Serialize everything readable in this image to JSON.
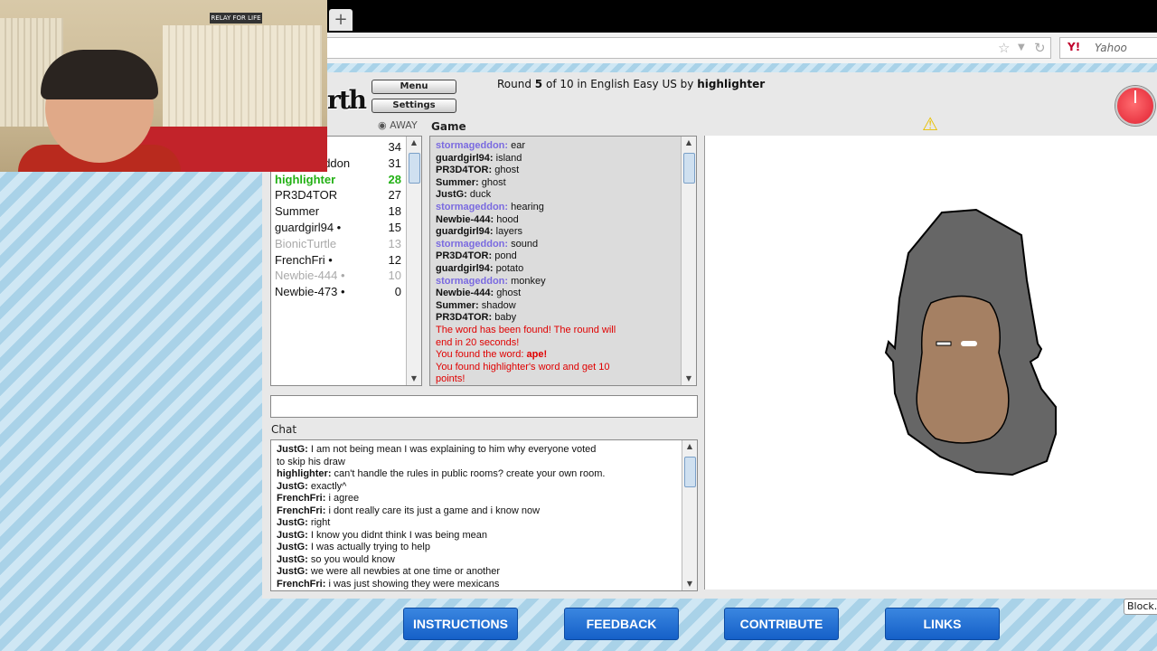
{
  "browser": {
    "newtab": "+",
    "search_engine": "Yahoo",
    "search_logo": "Y!"
  },
  "webcam": {
    "poster_text": "RELAY FOR LIFE"
  },
  "game": {
    "menu_label": "Menu",
    "settings_label": "Settings",
    "logo_text": "rth",
    "round_prefix": "Round ",
    "round_num": "5",
    "round_mid": " of 10 in English Easy US by ",
    "drawer": "highlighter",
    "away_label": "AWAY",
    "game_label": "Game",
    "chat_label": "Chat",
    "block_label": "Block..."
  },
  "players": [
    {
      "name": "",
      "score": "34",
      "color": "#111"
    },
    {
      "name": "stormageddon",
      "score": "31",
      "color": "#111"
    },
    {
      "name": "highlighter",
      "score": "28",
      "color": "#22b014"
    },
    {
      "name": "PR3D4TOR",
      "score": "27",
      "color": "#111"
    },
    {
      "name": "Summer",
      "score": "18",
      "color": "#111"
    },
    {
      "name": "guardgirl94 •",
      "score": "15",
      "color": "#111"
    },
    {
      "name": "BionicTurtle",
      "score": "13",
      "color": "#aaaaaa"
    },
    {
      "name": "FrenchFri •",
      "score": "12",
      "color": "#111"
    },
    {
      "name": "Newbie-444 •",
      "score": "10",
      "color": "#aaaaaa"
    },
    {
      "name": "Newbie-473 •",
      "score": "0",
      "color": "#111"
    }
  ],
  "game_log": [
    {
      "user": "stormageddon:",
      "text": " ear",
      "ucolor": "#7a6ae0",
      "tcolor": "#111"
    },
    {
      "user": "guardgirl94:",
      "text": " island",
      "ucolor": "#111",
      "tcolor": "#111"
    },
    {
      "user": "PR3D4TOR:",
      "text": " ghost",
      "ucolor": "#111",
      "tcolor": "#111"
    },
    {
      "user": "Summer:",
      "text": " ghost",
      "ucolor": "#111",
      "tcolor": "#111"
    },
    {
      "user": "JustG:",
      "text": " duck",
      "ucolor": "#111",
      "tcolor": "#111"
    },
    {
      "user": "stormageddon:",
      "text": " hearing",
      "ucolor": "#7a6ae0",
      "tcolor": "#111"
    },
    {
      "user": "Newbie-444:",
      "text": " hood",
      "ucolor": "#111",
      "tcolor": "#111"
    },
    {
      "user": "guardgirl94:",
      "text": " layers",
      "ucolor": "#111",
      "tcolor": "#111"
    },
    {
      "user": "stormageddon:",
      "text": " sound",
      "ucolor": "#7a6ae0",
      "tcolor": "#111"
    },
    {
      "user": "PR3D4TOR:",
      "text": " pond",
      "ucolor": "#111",
      "tcolor": "#111"
    },
    {
      "user": "guardgirl94:",
      "text": " potato",
      "ucolor": "#111",
      "tcolor": "#111"
    },
    {
      "user": "stormageddon:",
      "text": " monkey",
      "ucolor": "#7a6ae0",
      "tcolor": "#111"
    },
    {
      "user": "Newbie-444:",
      "text": " ghost",
      "ucolor": "#111",
      "tcolor": "#111"
    },
    {
      "user": "Summer:",
      "text": " shadow",
      "ucolor": "#111",
      "tcolor": "#111"
    },
    {
      "user": "PR3D4TOR:",
      "text": " baby",
      "ucolor": "#111",
      "tcolor": "#111"
    },
    {
      "user": "",
      "text": "The word has been found! The round will",
      "ucolor": "#e00000",
      "tcolor": "#e00000"
    },
    {
      "user": "",
      "text": "end in 20 seconds!",
      "ucolor": "#e00000",
      "tcolor": "#e00000"
    },
    {
      "user": "",
      "text": "You found the word: ",
      "ucolor": "#e00000",
      "tcolor": "#e00000",
      "extra": "ape!"
    },
    {
      "user": "",
      "text": "You found highlighter's word and get 10",
      "ucolor": "#e00000",
      "tcolor": "#e00000"
    },
    {
      "user": "",
      "text": "points!",
      "ucolor": "#e00000",
      "tcolor": "#e00000"
    }
  ],
  "chat_log": [
    {
      "user": "JustG:",
      "text": " I am not being mean I was explaining to him why everyone voted"
    },
    {
      "user": "",
      "text": "to skip his draw"
    },
    {
      "user": "highlighter:",
      "text": " can't handle the rules in public rooms? create your own room."
    },
    {
      "user": "JustG:",
      "text": " exactly^"
    },
    {
      "user": "FrenchFri:",
      "text": " i agree"
    },
    {
      "user": "FrenchFri:",
      "text": " i dont really care its just a game and i know now"
    },
    {
      "user": "JustG:",
      "text": " right"
    },
    {
      "user": "JustG:",
      "text": " I know you didnt think I was being mean"
    },
    {
      "user": "JustG:",
      "text": " I was actually trying to help"
    },
    {
      "user": "JustG:",
      "text": " so you would know"
    },
    {
      "user": "JustG:",
      "text": " we were all newbies at one time or another"
    },
    {
      "user": "FrenchFri:",
      "text": " i was just showing they were mexicans"
    }
  ],
  "nav": {
    "instructions": "INSTRUCTIONS",
    "feedback": "FEEDBACK",
    "contribute": "CONTRIBUTE",
    "links": "LINKS"
  },
  "colors": {
    "hood": "#666666",
    "face": "#a58063",
    "accent_button": "#2a78dc"
  }
}
